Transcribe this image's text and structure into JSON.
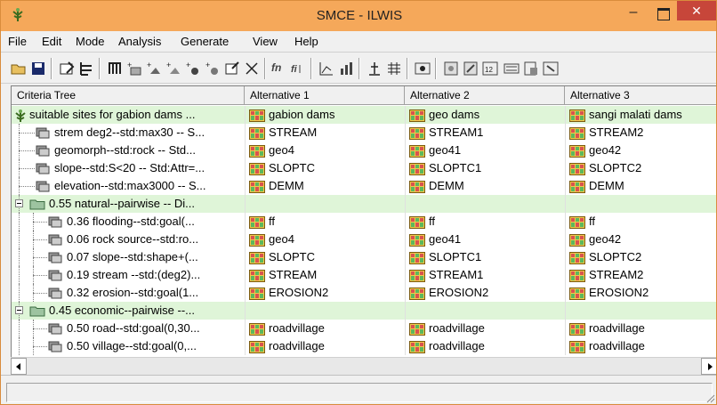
{
  "window": {
    "title": "SMCE - ILWIS"
  },
  "menu": [
    "File",
    "Edit",
    "Mode",
    "Analysis",
    "Generate",
    "View",
    "Help"
  ],
  "toolbar": {
    "fn_label": "fn",
    "number_label": "12"
  },
  "columns": [
    "Criteria Tree",
    "Alternative 1",
    "Alternative 2",
    "Alternative 3"
  ],
  "rows": [
    {
      "label": "suitable sites for gabion dams ...",
      "level": 0,
      "type": "goal",
      "alts": [
        "gabion dams",
        "geo dams",
        "sangi malati dams"
      ]
    },
    {
      "label": "strem deg2--std:max30 -- S...",
      "level": 1,
      "type": "factor",
      "alts": [
        "STREAM",
        "STREAM1",
        "STREAM2"
      ]
    },
    {
      "label": "geomorph--std:rock -- Std...",
      "level": 1,
      "type": "factor",
      "alts": [
        "geo4",
        "geo41",
        "geo42"
      ]
    },
    {
      "label": "slope--std:S<20 -- Std:Attr=...",
      "level": 1,
      "type": "factor",
      "alts": [
        "SLOPTC",
        "SLOPTC1",
        "SLOPTC2"
      ]
    },
    {
      "label": "elevation--std:max3000 -- S...",
      "level": 1,
      "type": "factor",
      "alts": [
        "DEMM",
        "DEMM",
        "DEMM"
      ]
    },
    {
      "label": "0.55 natural--pairwise -- Di...",
      "level": 1,
      "type": "group",
      "alts": [
        "",
        "",
        ""
      ]
    },
    {
      "label": "0.36 flooding--std:goal(...",
      "level": 2,
      "type": "factor",
      "alts": [
        "ff",
        "ff",
        "ff"
      ]
    },
    {
      "label": "0.06 rock source--std:ro...",
      "level": 2,
      "type": "factor",
      "alts": [
        "geo4",
        "geo41",
        "geo42"
      ]
    },
    {
      "label": "0.07 slope--std:shape+(...",
      "level": 2,
      "type": "factor",
      "alts": [
        "SLOPTC",
        "SLOPTC1",
        "SLOPTC2"
      ]
    },
    {
      "label": "0.19 stream --std:(deg2)...",
      "level": 2,
      "type": "factor",
      "alts": [
        "STREAM",
        "STREAM1",
        "STREAM2"
      ]
    },
    {
      "label": "0.32 erosion--std:goal(1...",
      "level": 2,
      "type": "factor",
      "alts": [
        "EROSION2",
        "EROSION2",
        "EROSION2"
      ]
    },
    {
      "label": "0.45 economic--pairwise --...",
      "level": 1,
      "type": "group",
      "alts": [
        "",
        "",
        ""
      ]
    },
    {
      "label": "0.50 road--std:goal(0,30...",
      "level": 2,
      "type": "factor",
      "alts": [
        "roadvillage",
        "roadvillage",
        "roadvillage"
      ]
    },
    {
      "label": "0.50 village--std:goal(0,...",
      "level": 2,
      "type": "factor",
      "alts": [
        "roadvillage",
        "roadvillage",
        "roadvillage"
      ]
    }
  ],
  "colors": {
    "titlebar": "#f5a85a",
    "close": "#c7463a",
    "highlight": "#dff5d8"
  },
  "icons": {
    "app": "tree-icon",
    "map": "raster-map-icon",
    "group": "folder-icon",
    "factor": "factor-icon",
    "toolbar": [
      "open-icon",
      "save-icon",
      "edit-tree-icon",
      "tree-view-icon",
      "columns-icon",
      "add-group-icon",
      "add-factor-icon",
      "add-constraint-icon",
      "add-score-icon",
      "add-effect-icon",
      "properties-icon",
      "delete-icon",
      "function-icon",
      "weights-icon",
      "graph-icon",
      "stats-icon",
      "balance-icon",
      "grid-icon",
      "eye-icon",
      "map-icon",
      "zoom-icon",
      "number-icon",
      "list-icon",
      "doc-icon",
      "window-icon"
    ]
  }
}
